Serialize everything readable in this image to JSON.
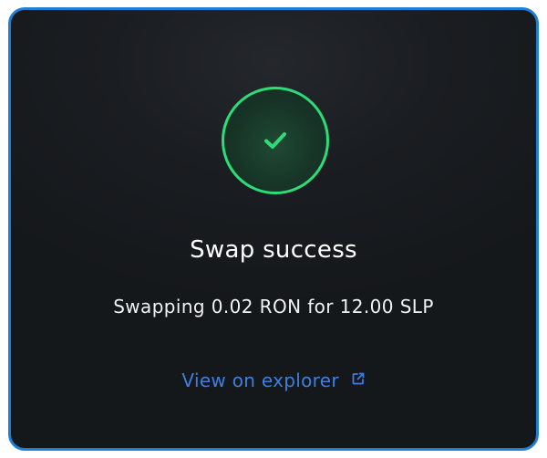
{
  "dialog": {
    "title": "Swap success",
    "message": "Swapping 0.02 RON for 12.00 SLP",
    "link_label": "View on explorer",
    "status_icon": "checkmark-icon",
    "link_icon": "external-link-icon"
  },
  "colors": {
    "border": "#1f7fd6",
    "background": "#1a1d21",
    "success": "#2ddc78",
    "link": "#3d7fe0"
  }
}
